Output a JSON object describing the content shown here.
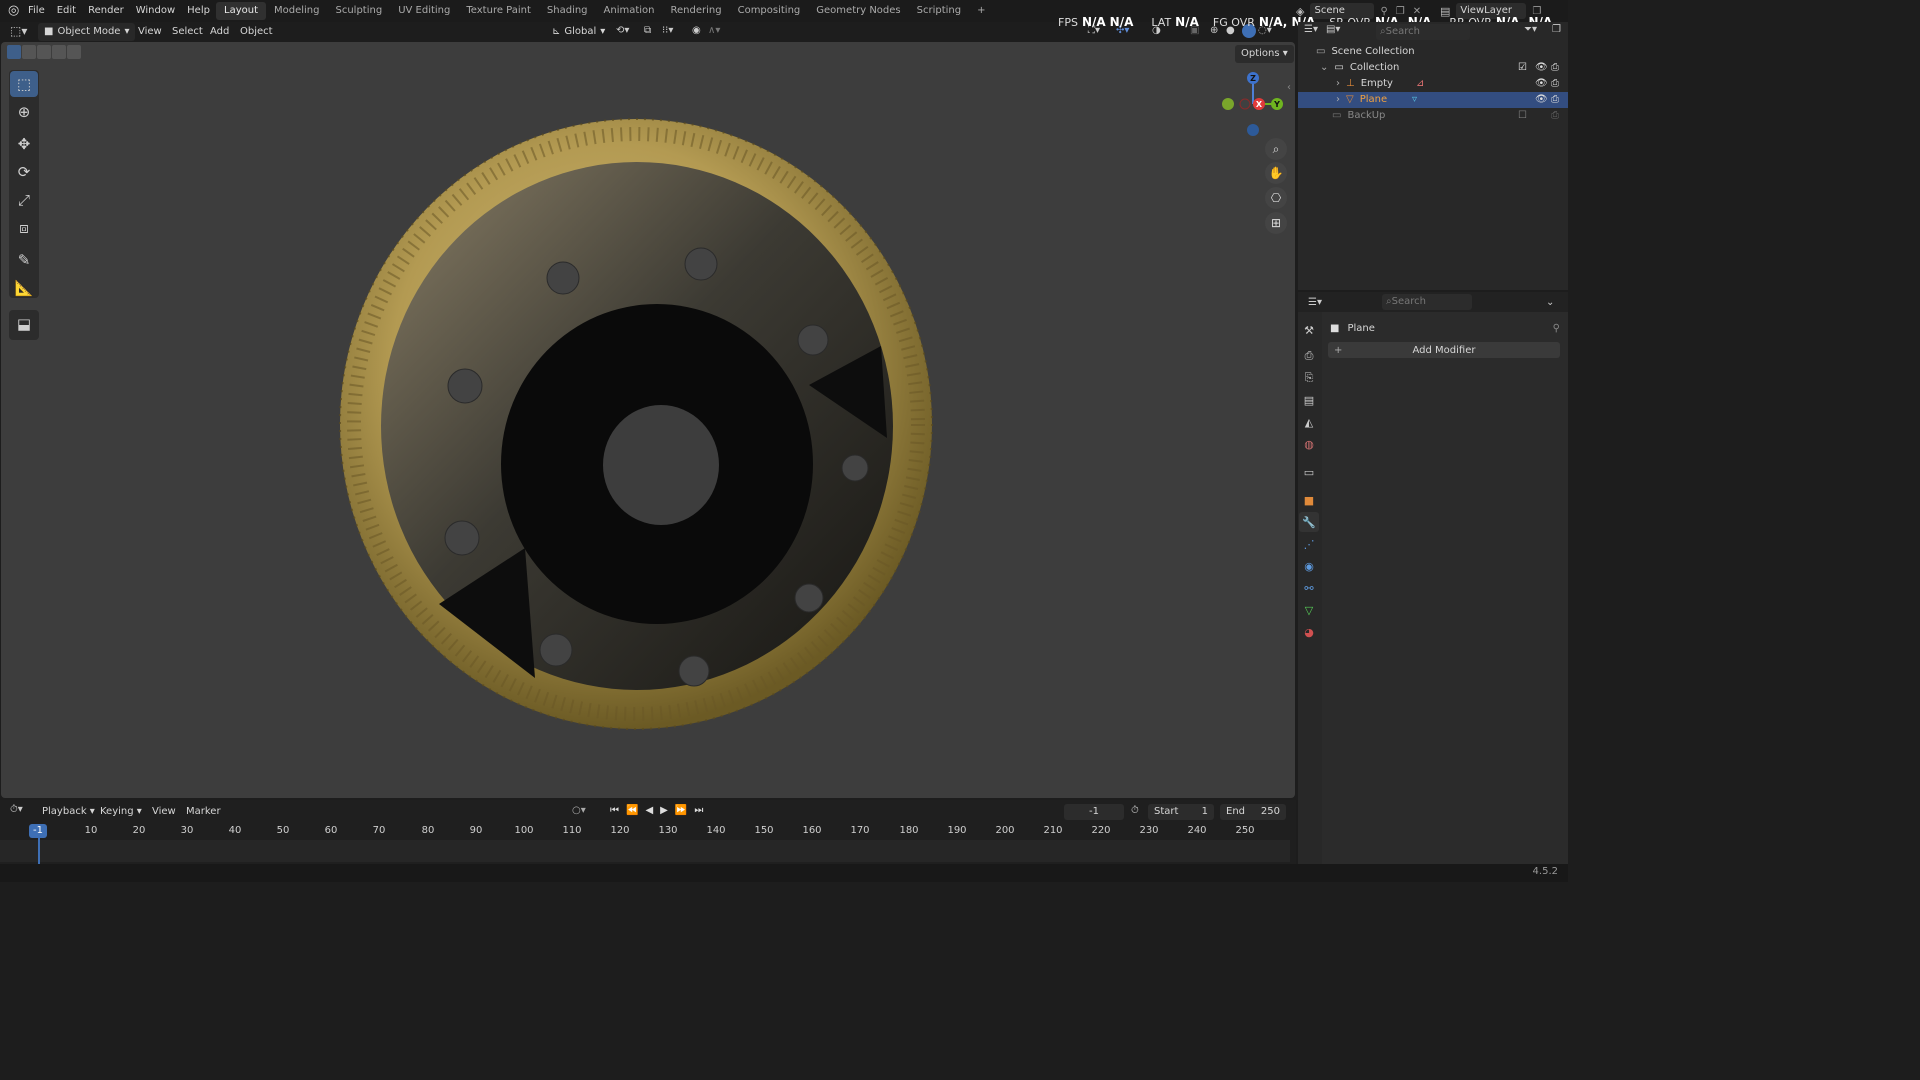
{
  "app": {
    "version": "4.5.2"
  },
  "menu": [
    "File",
    "Edit",
    "Render",
    "Window",
    "Help"
  ],
  "workspaces": [
    "Layout",
    "Modeling",
    "Sculpting",
    "UV Editing",
    "Texture Paint",
    "Shading",
    "Animation",
    "Rendering",
    "Compositing",
    "Geometry Nodes",
    "Scripting"
  ],
  "active_workspace": "Layout",
  "scene": {
    "name": "Scene",
    "view_layer": "ViewLayer"
  },
  "stats": {
    "fps_label": "FPS",
    "fps_value": "N/A",
    "fps_value2": "N/A",
    "lat_label": "LAT",
    "lat_value": "N/A",
    "fgovr_label": "FG OVR",
    "fgovr_value": "N/A, N/A",
    "srovr_label": "SR OVR",
    "srovr_value": "N/A, N/A",
    "rrovr_label": "RR OVR",
    "rrovr_value": "N/A, N/A"
  },
  "viewport_header": {
    "mode": "Object Mode",
    "menus": [
      "View",
      "Select",
      "Add",
      "Object"
    ],
    "orientation": "Global",
    "options_label": "Options"
  },
  "gizmo": {
    "x": "X",
    "y": "Y",
    "z": "Z"
  },
  "outliner": {
    "search_placeholder": "Search",
    "root": "Scene Collection",
    "collection": "Collection",
    "items": [
      "Empty",
      "Plane"
    ],
    "backup": "BackUp",
    "selected": "Plane"
  },
  "properties": {
    "search_placeholder": "Search",
    "object_name": "Plane",
    "add_modifier_label": "Add Modifier"
  },
  "timeline": {
    "menus": [
      "Playback",
      "Keying",
      "View",
      "Marker"
    ],
    "current_frame": "-1",
    "start_label": "Start",
    "start_value": "1",
    "end_label": "End",
    "end_value": "250",
    "ruler_current": "-1",
    "ruler": [
      "10",
      "20",
      "30",
      "40",
      "50",
      "60",
      "70",
      "80",
      "90",
      "100",
      "110",
      "120",
      "130",
      "140",
      "150",
      "160",
      "170",
      "180",
      "190",
      "200",
      "210",
      "220",
      "230",
      "240",
      "250"
    ]
  },
  "colors": {
    "accent": "#3e5f8a",
    "selection": "#334d80",
    "gold": "#b39a52"
  }
}
